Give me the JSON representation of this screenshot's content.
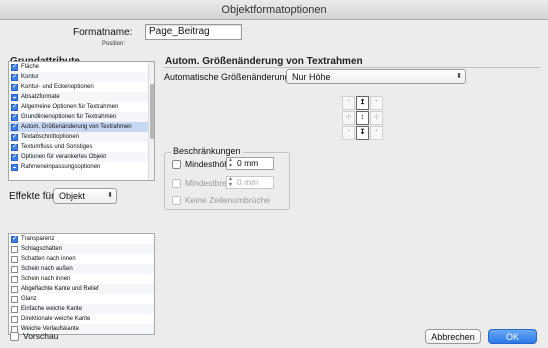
{
  "window": {
    "title": "Objektformatoptionen"
  },
  "format": {
    "name_label": "Formatname:",
    "name_value": "Page_Beitrag",
    "position_label": "Position:"
  },
  "left": {
    "heading": "Grundattribute",
    "basic_items": [
      {
        "label": "Fläche",
        "state": "checked"
      },
      {
        "label": "Kontur",
        "state": "checked"
      },
      {
        "label": "Kontur- und Eckenoptionen",
        "state": "checked"
      },
      {
        "label": "Absatzformate",
        "state": "dash"
      },
      {
        "label": "Allgemeine Optionen für Textrahmen",
        "state": "checked"
      },
      {
        "label": "Grundlinienoptionen für Textrahmen",
        "state": "checked"
      },
      {
        "label": "Autom. Größenänderung von Textrahmen",
        "state": "checked"
      },
      {
        "label": "Textabschnittoptionen",
        "state": "checked"
      },
      {
        "label": "Textumfluss und Sonstiges",
        "state": "checked"
      },
      {
        "label": "Optionen für verankertes Objekt",
        "state": "checked"
      },
      {
        "label": "Rahmeneinpassungsoptionen",
        "state": "dash"
      }
    ],
    "effects_label": "Effekte für:",
    "effects_value": "Objekt",
    "effect_items": [
      {
        "label": "Transparenz",
        "state": "checked"
      },
      {
        "label": "Schlagschatten",
        "state": "empty"
      },
      {
        "label": "Schatten nach innen",
        "state": "empty"
      },
      {
        "label": "Schein nach außen",
        "state": "empty"
      },
      {
        "label": "Schein nach innen",
        "state": "empty"
      },
      {
        "label": "Abgeflachte Kante und Relief",
        "state": "empty"
      },
      {
        "label": "Glanz",
        "state": "empty"
      },
      {
        "label": "Einfache weiche Kante",
        "state": "empty"
      },
      {
        "label": "Direktionale weiche Kante",
        "state": "empty"
      },
      {
        "label": "Weiche Verlaufskante",
        "state": "empty"
      }
    ],
    "preview_label": "Vorschau"
  },
  "right": {
    "heading": "Autom. Größenänderung von Textrahmen",
    "auto_label": "Automatische Größenänderung",
    "auto_value": "Nur Höhe",
    "restrictions": {
      "legend": "Beschränkungen",
      "min_height_label": "Mindesthöhe:",
      "min_height_value": "0 mm",
      "min_width_label": "Mindestbreite:",
      "min_width_value": "0 mm",
      "no_line_breaks_label": "Keine Zeilenumbrüche"
    }
  },
  "footer": {
    "cancel_label": "Abbrechen",
    "ok_label": "OK"
  }
}
